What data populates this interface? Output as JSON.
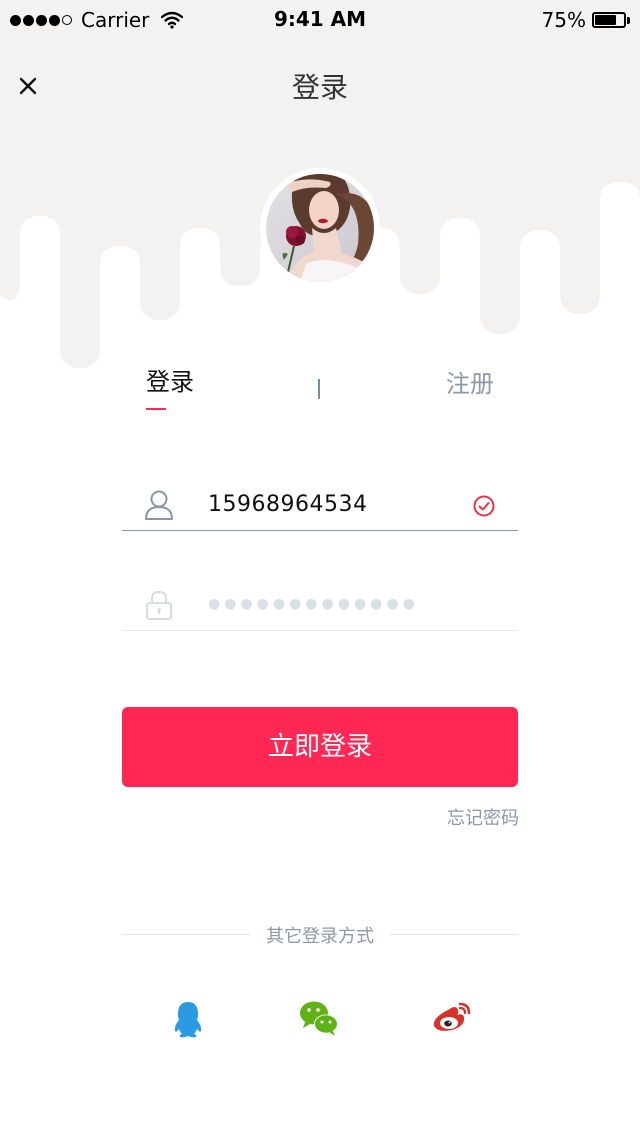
{
  "status_bar": {
    "carrier": "Carrier",
    "time": "9:41 AM",
    "battery_percent": "75%",
    "battery_level": 0.75,
    "signal_bars_filled": 4,
    "signal_bars_total": 5
  },
  "nav": {
    "title": "登录",
    "close_icon": "close-icon"
  },
  "tabs": {
    "login_label": "登录",
    "register_label": "注册",
    "active": "login"
  },
  "form": {
    "phone_value": "15968964534",
    "phone_icon": "user-icon",
    "phone_valid_icon": "check-circle-icon",
    "password_value": "●●●●●●●●●●●●●",
    "password_icon": "lock-icon",
    "submit_label": "立即登录",
    "forgot_label": "忘记密码"
  },
  "other_login": {
    "label": "其它登录方式",
    "providers": [
      {
        "name": "QQ",
        "icon": "qq-icon"
      },
      {
        "name": "WeChat",
        "icon": "wechat-icon"
      },
      {
        "name": "Weibo",
        "icon": "weibo-icon"
      }
    ]
  },
  "colors": {
    "accent": "#ff2753",
    "header_bg": "#f4f2f1",
    "muted_text": "#8d98a8",
    "qq": "#2a9be2",
    "wechat": "#5fb317",
    "weibo": "#d9322c"
  }
}
